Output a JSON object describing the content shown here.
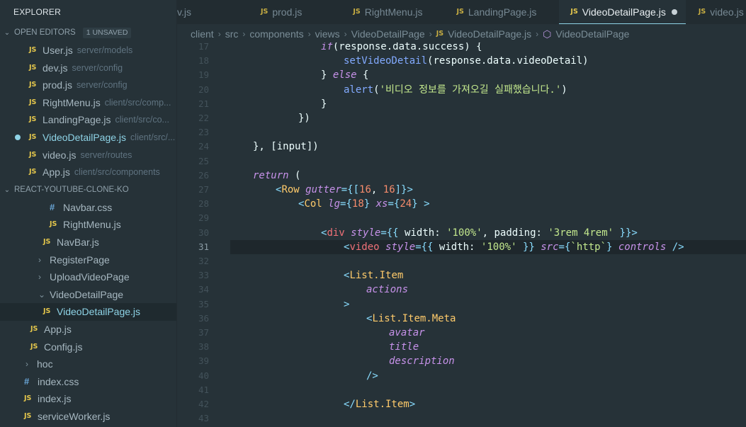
{
  "sidebar": {
    "title": "EXPLORER",
    "open_editors": {
      "label": "OPEN EDITORS",
      "badge": "1 UNSAVED",
      "items": [
        {
          "icon": "JS",
          "name": "User.js",
          "path": "server/models"
        },
        {
          "icon": "JS",
          "name": "dev.js",
          "path": "server/config"
        },
        {
          "icon": "JS",
          "name": "prod.js",
          "path": "server/config"
        },
        {
          "icon": "JS",
          "name": "RightMenu.js",
          "path": "client/src/comp..."
        },
        {
          "icon": "JS",
          "name": "LandingPage.js",
          "path": "client/src/co..."
        },
        {
          "icon": "JS",
          "name": "VideoDetailPage.js",
          "path": "client/src/..."
        },
        {
          "icon": "JS",
          "name": "video.js",
          "path": "server/routes"
        },
        {
          "icon": "JS",
          "name": "App.js",
          "path": "client/src/components"
        }
      ]
    },
    "project": {
      "label": "REACT-YOUTUBE-CLONE-KO",
      "items": [
        {
          "icon": "#",
          "name": "Navbar.css"
        },
        {
          "icon": "JS",
          "name": "RightMenu.js"
        },
        {
          "icon": "JS",
          "name": "NavBar.js"
        },
        {
          "icon": ">",
          "name": "RegisterPage"
        },
        {
          "icon": ">",
          "name": "UploadVideoPage"
        },
        {
          "icon": "v",
          "name": "VideoDetailPage"
        },
        {
          "icon": "JS",
          "name": "VideoDetailPage.js"
        },
        {
          "icon": "JS",
          "name": "App.js"
        },
        {
          "icon": "JS",
          "name": "Config.js"
        },
        {
          "icon": ">",
          "name": "hoc"
        },
        {
          "icon": "#",
          "name": "index.css"
        },
        {
          "icon": "JS",
          "name": "index.js"
        },
        {
          "icon": "JS",
          "name": "serviceWorker.js"
        }
      ]
    }
  },
  "tabs": [
    {
      "icon": "",
      "label": "v.js"
    },
    {
      "icon": "JS",
      "label": "prod.js"
    },
    {
      "icon": "JS",
      "label": "RightMenu.js"
    },
    {
      "icon": "JS",
      "label": "LandingPage.js"
    },
    {
      "icon": "JS",
      "label": "VideoDetailPage.js"
    },
    {
      "icon": "JS",
      "label": "video.js"
    }
  ],
  "breadcrumb": {
    "parts": [
      "client",
      "src",
      "components",
      "views",
      "VideoDetailPage"
    ],
    "file": "VideoDetailPage.js",
    "symbol": "VideoDetailPage"
  },
  "editor": {
    "line_numbers": [
      "17",
      "18",
      "19",
      "20",
      "21",
      "22",
      "23",
      "24",
      "25",
      "26",
      "27",
      "28",
      "29",
      "30",
      "31",
      "32",
      "33",
      "34",
      "35",
      "36",
      "37",
      "38",
      "39",
      "40",
      "41",
      "42",
      "43"
    ],
    "current_line": "31",
    "strings": {
      "alert_msg": "'비디오 정보를 가져오길 실패했습니다.'",
      "width_100": "'100%'",
      "padding": "'3rem 4rem'",
      "http": "`http`"
    },
    "numbers": {
      "gutter": "16",
      "lg": "18",
      "xs": "24"
    }
  }
}
